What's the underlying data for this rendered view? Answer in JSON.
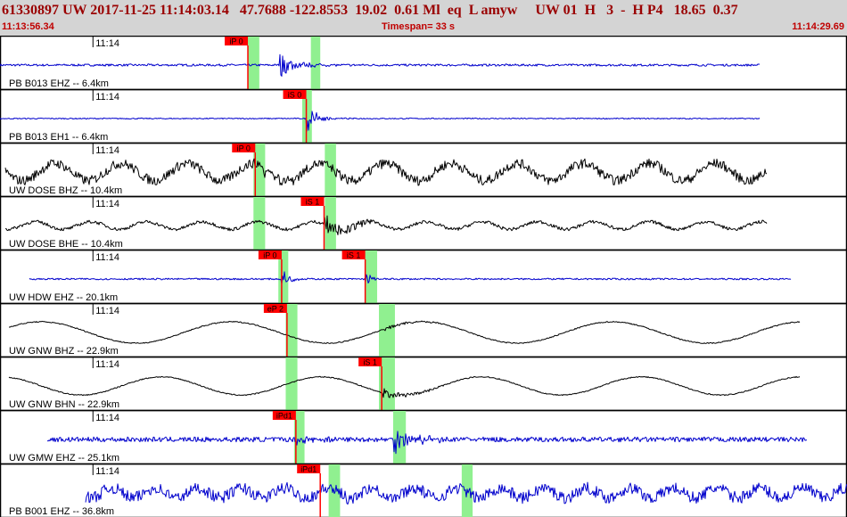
{
  "header": {
    "event_line": "61330897 UW 2017-11-25 11:14:03.14   47.7688 -122.8553  19.02  0.61 Ml  eq  L amyw     UW 01  H   3  -  H P4   18.65  0.37",
    "start_time": "11:13:56.34",
    "timespan": "Timespan=  33 s",
    "end_time": "11:14:29.69"
  },
  "colors": {
    "trace_vertical": "#0000cc",
    "trace_horizontal": "#000000",
    "pick_box": "#ff0000",
    "window": "#90f090",
    "panel_border": "#000000"
  },
  "chart_data": {
    "type": "line",
    "title": "",
    "x_unit": "s",
    "xlim": [
      0,
      33.35
    ],
    "minute_tick_label": "11:14",
    "minute_tick_at": 3.66,
    "panels": [
      {
        "label": "PB B013 EHZ -- 6.4km",
        "trace_color": "blue",
        "picks": [
          {
            "label": "iP 0",
            "at": 9.76
          }
        ],
        "windows": [
          [
            9.76,
            10.21
          ],
          [
            12.24,
            12.61
          ]
        ],
        "waves": [
          {
            "kind": "noise",
            "from": 0.0,
            "to": 29.94,
            "amp": 0.04
          },
          {
            "kind": "burst",
            "from": 11.0,
            "to": 14.2,
            "amp": 0.5,
            "decay": 0.6
          }
        ]
      },
      {
        "label": "PB B013 EH1 -- 6.4km",
        "trace_color": "blue",
        "picks": [
          {
            "label": "iS 0",
            "at": 12.06
          }
        ],
        "windows": [
          [
            11.9,
            12.28
          ]
        ],
        "waves": [
          {
            "kind": "noise",
            "from": 0.0,
            "to": 29.94,
            "amp": 0.02
          },
          {
            "kind": "burst",
            "from": 12.06,
            "to": 14.5,
            "amp": 0.55,
            "decay": 0.4
          }
        ]
      },
      {
        "label": "UW DOSE BHZ -- 10.4km",
        "trace_color": "black",
        "picks": [
          {
            "label": "iP 0",
            "at": 10.05
          }
        ],
        "windows": [
          [
            9.98,
            10.44
          ],
          [
            12.79,
            13.23
          ]
        ],
        "waves": [
          {
            "kind": "sine",
            "from": 0.18,
            "to": 30.22,
            "amp": 0.32,
            "period": 2.6
          },
          {
            "kind": "noise",
            "from": 0.18,
            "to": 30.22,
            "amp": 0.18
          },
          {
            "kind": "burst",
            "from": 10.05,
            "to": 13.8,
            "amp": 0.28,
            "decay": 1.2
          }
        ]
      },
      {
        "label": "UW DOSE BHE -- 10.4km",
        "trace_color": "black",
        "picks": [
          {
            "label": "iS 1",
            "at": 12.76
          }
        ],
        "windows": [
          [
            9.98,
            10.44
          ],
          [
            12.79,
            13.23
          ]
        ],
        "waves": [
          {
            "kind": "sine",
            "from": 0.18,
            "to": 30.22,
            "amp": 0.14,
            "period": 2.2
          },
          {
            "kind": "noise",
            "from": 0.18,
            "to": 30.22,
            "amp": 0.06
          },
          {
            "kind": "burst",
            "from": 12.76,
            "to": 16.0,
            "amp": 0.42,
            "decay": 0.9
          }
        ]
      },
      {
        "label": "UW HDW EHZ -- 20.1km",
        "trace_color": "blue",
        "picks": [
          {
            "label": "iP 0",
            "at": 11.09
          },
          {
            "label": "iS 1",
            "at": 14.38
          }
        ],
        "windows": [
          [
            10.96,
            11.35
          ],
          [
            14.37,
            14.85
          ]
        ],
        "waves": [
          {
            "kind": "noise",
            "from": 1.14,
            "to": 31.15,
            "amp": 0.03
          },
          {
            "kind": "burst",
            "from": 11.09,
            "to": 12.3,
            "amp": 0.5,
            "decay": 0.25
          },
          {
            "kind": "burst",
            "from": 14.38,
            "to": 15.3,
            "amp": 0.25,
            "decay": 0.3
          }
        ]
      },
      {
        "label": "UW GNW BHZ -- 22.9km",
        "trace_color": "black",
        "picks": [
          {
            "label": "eP 2",
            "at": 11.3
          }
        ],
        "windows": [
          [
            11.25,
            11.71
          ],
          [
            14.92,
            15.55
          ]
        ],
        "waves": [
          {
            "kind": "sine",
            "from": 0.32,
            "to": 31.5,
            "amp": 0.4,
            "period": 7.5
          },
          {
            "kind": "noise",
            "from": 0.32,
            "to": 31.5,
            "amp": 0.02
          },
          {
            "kind": "burst",
            "from": 15.1,
            "to": 18.0,
            "amp": 0.08,
            "decay": 1.2
          }
        ]
      },
      {
        "label": "UW GNW BHN -- 22.9km",
        "trace_color": "black",
        "picks": [
          {
            "label": "iS 1",
            "at": 15.03
          }
        ],
        "windows": [
          [
            11.25,
            11.71
          ],
          [
            14.92,
            15.55
          ]
        ],
        "waves": [
          {
            "kind": "sine",
            "from": 0.32,
            "to": 31.5,
            "amp": 0.34,
            "period": 6.3
          },
          {
            "kind": "noise",
            "from": 0.32,
            "to": 31.5,
            "amp": 0.02
          },
          {
            "kind": "burst",
            "from": 15.03,
            "to": 19.0,
            "amp": 0.2,
            "decay": 1.0
          }
        ]
      },
      {
        "label": "UW GMW EHZ -- 25.1km",
        "trace_color": "blue",
        "picks": [
          {
            "label": "iPd1",
            "at": 11.65
          }
        ],
        "windows": [
          [
            11.58,
            11.99
          ],
          [
            15.48,
            15.98
          ]
        ],
        "waves": [
          {
            "kind": "noise",
            "from": 1.86,
            "to": 31.8,
            "amp": 0.09
          },
          {
            "kind": "burst",
            "from": 11.65,
            "to": 13.0,
            "amp": 0.22,
            "decay": 0.6
          },
          {
            "kind": "burst",
            "from": 15.5,
            "to": 18.5,
            "amp": 0.55,
            "decay": 0.8
          }
        ]
      },
      {
        "label": "PB B001 EHZ -- 36.8km",
        "trace_color": "blue",
        "picks": [
          {
            "label": "iPd1",
            "at": 12.61
          }
        ],
        "windows": [
          [
            12.94,
            13.39
          ],
          [
            18.18,
            18.61
          ]
        ],
        "waves": [
          {
            "kind": "sine",
            "from": 3.37,
            "to": 33.35,
            "amp": 0.18,
            "period": 1.7
          },
          {
            "kind": "noise",
            "from": 3.37,
            "to": 33.35,
            "amp": 0.22
          },
          {
            "kind": "burst",
            "from": 13.0,
            "to": 15.0,
            "amp": 0.25,
            "decay": 0.8
          }
        ]
      }
    ]
  }
}
